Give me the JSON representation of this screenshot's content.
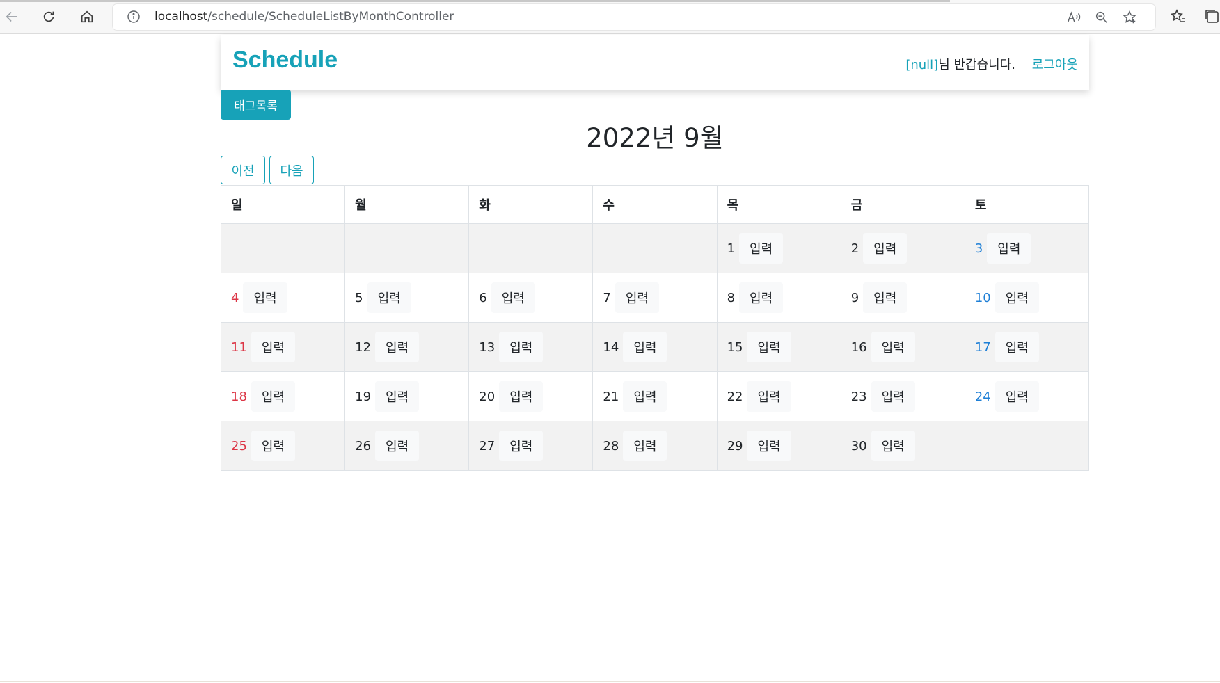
{
  "browser": {
    "url_host": "localhost",
    "url_path": "/schedule/ScheduleListByMonthController"
  },
  "navbar": {
    "brand": "Schedule",
    "user": "[null]",
    "greeting": "님 반갑습니다.",
    "logout_label": "로그아웃"
  },
  "tag_button_label": "태그목록",
  "month_title": "2022년 9월",
  "prev_label": "이전",
  "next_label": "다음",
  "calendar": {
    "weekdays": [
      "일",
      "월",
      "화",
      "수",
      "목",
      "금",
      "토"
    ],
    "input_label": "입력",
    "weeks": [
      [
        "",
        "",
        "",
        "",
        "1",
        "2",
        "3"
      ],
      [
        "4",
        "5",
        "6",
        "7",
        "8",
        "9",
        "10"
      ],
      [
        "11",
        "12",
        "13",
        "14",
        "15",
        "16",
        "17"
      ],
      [
        "18",
        "19",
        "20",
        "21",
        "22",
        "23",
        "24"
      ],
      [
        "25",
        "26",
        "27",
        "28",
        "29",
        "30",
        ""
      ]
    ]
  },
  "colors": {
    "accent": "#17a2b8",
    "sunday": "#dc3545",
    "saturday": "#1e7fd6",
    "stripe": "#f2f2f2"
  }
}
